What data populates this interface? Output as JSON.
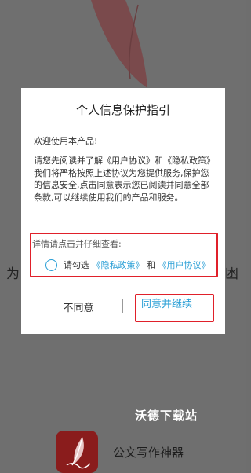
{
  "dialog": {
    "title": "个人信息保护指引",
    "welcome": "欢迎使用本产品!",
    "body": "请您先阅读并了解《用户协议》和《隐私政策》我们将严格按照上述协议为您提供服务,保护您的信息安全,点击同意表示您已阅读并同意全部条款,可以继续使用我们的产品和服务。",
    "detail_hint": "详情请点击并仔细查看:",
    "consent": {
      "prefix": "请勾选",
      "privacy_link": "《隐私政策》",
      "and": "和",
      "user_link": "《用户协议》"
    },
    "disagree_label": "不同意",
    "agree_label": "同意并继续"
  },
  "background": {
    "left_edge_text": "为",
    "right_edge_text": "凼"
  },
  "watermark": "沃德下载站",
  "app": {
    "name": "公文写作神器",
    "icon": "feather-pen-icon"
  },
  "colors": {
    "overlay": "#6f6f6f",
    "feather": "#7a4a4c",
    "link": "#2a9fd6",
    "highlight_border": "#e0202a",
    "app_icon": "#8a1c1c"
  }
}
